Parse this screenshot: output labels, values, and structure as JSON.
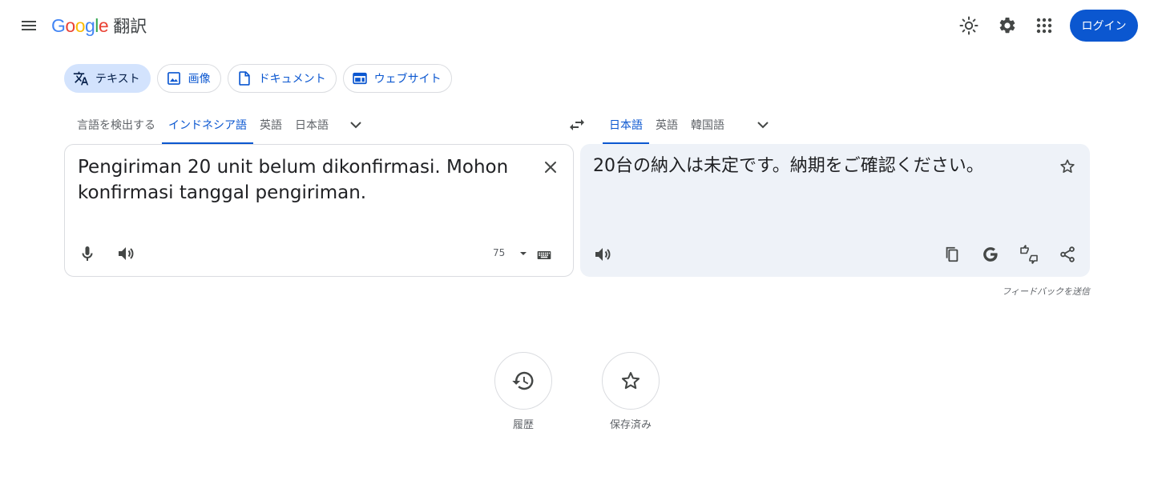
{
  "header": {
    "product_name": "翻訳",
    "login_label": "ログイン",
    "menu_icon": "hamburger-menu-icon",
    "theme_icon": "light-mode-icon",
    "settings_icon": "gear-icon",
    "apps_icon": "apps-grid-icon"
  },
  "modes": [
    {
      "label": "テキスト",
      "icon": "translate-icon",
      "active": true
    },
    {
      "label": "画像",
      "icon": "image-icon"
    },
    {
      "label": "ドキュメント",
      "icon": "document-icon"
    },
    {
      "label": "ウェブサイト",
      "icon": "website-icon"
    }
  ],
  "source_langs": [
    "言語を検出する",
    "インドネシア語",
    "英語",
    "日本語"
  ],
  "source_active": "インドネシア語",
  "target_langs": [
    "日本語",
    "英語",
    "韓国語"
  ],
  "target_active": "日本語",
  "source": {
    "text": "Pengiriman 20 unit belum dikonfirmasi. Mohon konfirmasi tanggal pengiriman.",
    "char_count": "75"
  },
  "target": {
    "text": "20台の納入は未定です。納期をご確認ください。"
  },
  "feedback_label": "フィードバックを送信",
  "bottom": {
    "history_label": "履歴",
    "saved_label": "保存済み"
  },
  "colors": {
    "accent": "#0b57d0",
    "active_chip_bg": "#d3e3fd",
    "target_panel_bg": "#eef2f8",
    "border": "#dadce0",
    "secondary_text": "#5f6368"
  }
}
